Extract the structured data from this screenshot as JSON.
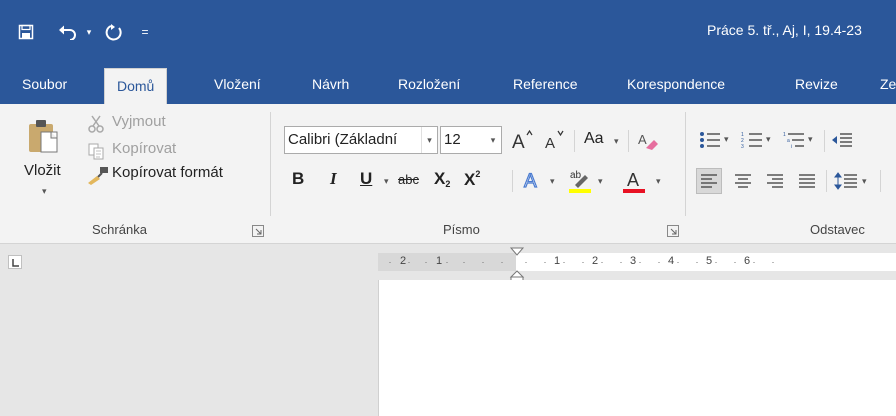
{
  "app": {
    "document_title": "Práce 5. tř., Aj, I, 19.4-23"
  },
  "tabs": [
    {
      "label": "Soubor"
    },
    {
      "label": "Domů"
    },
    {
      "label": "Vložení"
    },
    {
      "label": "Návrh"
    },
    {
      "label": "Rozložení"
    },
    {
      "label": "Reference"
    },
    {
      "label": "Korespondence"
    },
    {
      "label": "Revize"
    },
    {
      "label": "Ze"
    }
  ],
  "clipboard": {
    "paste_label": "Vložit",
    "cut_label": "Vyjmout",
    "copy_label": "Kopírovat",
    "format_painter_label": "Kopírovat formát",
    "group_label": "Schránka"
  },
  "font": {
    "font_name": "Calibri (Základní",
    "font_size": "12",
    "change_case_label": "Aa",
    "bold": "B",
    "italic": "I",
    "underline": "U",
    "strikethrough": "abc",
    "subscript": "X",
    "superscript": "X",
    "highlight_color": "#ffff00",
    "font_color": "#e81123",
    "group_label": "Písmo"
  },
  "paragraph": {
    "group_label": "Odstavec"
  },
  "ruler": {
    "labels": [
      "2",
      "1",
      "1",
      "2",
      "3",
      "4",
      "5",
      "6"
    ]
  },
  "colors": {
    "brand_blue": "#2b579a",
    "ribbon_bg": "#f3f3f3"
  }
}
